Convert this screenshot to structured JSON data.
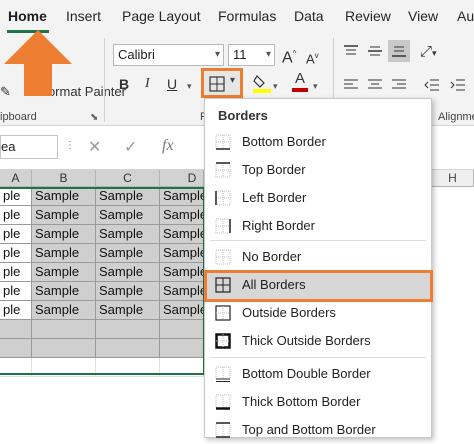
{
  "ribbon_tabs": {
    "home": "Home",
    "insert": "Insert",
    "page_layout": "Page Layout",
    "formulas": "Formulas",
    "data": "Data",
    "review": "Review",
    "view": "View",
    "au": "Au"
  },
  "clipboard": {
    "format_painter": "Format Painter",
    "group_label": "ipboard"
  },
  "font": {
    "name": "Calibri",
    "size": "11",
    "bold": "B",
    "italic": "I",
    "underline": "U",
    "grow_label": "A",
    "shrink_label": "A",
    "font_color_label": "A",
    "group_label": "F"
  },
  "alignment": {
    "group_label": "Alignme"
  },
  "formula_bar": {
    "name_box": "ea",
    "fx": "fx"
  },
  "columns": [
    "A",
    "B",
    "C",
    "D",
    "H"
  ],
  "rows": [
    [
      "ple",
      "Sample",
      "Sample",
      "Sample"
    ],
    [
      "ple",
      "Sample",
      "Sample",
      "Sample"
    ],
    [
      "ple",
      "Sample",
      "Sample",
      "Sample"
    ],
    [
      "ple",
      "Sample",
      "Sample",
      "Sample"
    ],
    [
      "ple",
      "Sample",
      "Sample",
      "Sample"
    ],
    [
      "ple",
      "Sample",
      "Sample",
      "Sample"
    ],
    [
      "ple",
      "Sample",
      "Sample",
      "Sample"
    ]
  ],
  "borders_menu": {
    "title": "Borders",
    "items": [
      {
        "label": "Bottom Border",
        "icon": "bottom-border-icon"
      },
      {
        "label": "Top Border",
        "icon": "top-border-icon"
      },
      {
        "label": "Left Border",
        "icon": "left-border-icon"
      },
      {
        "label": "Right Border",
        "icon": "right-border-icon"
      },
      {
        "label": "No Border",
        "icon": "no-border-icon"
      },
      {
        "label": "All Borders",
        "icon": "all-borders-icon",
        "highlighted": true
      },
      {
        "label": "Outside Borders",
        "icon": "outside-borders-icon"
      },
      {
        "label": "Thick Outside Borders",
        "icon": "thick-outside-borders-icon"
      },
      {
        "label": "Bottom Double Border",
        "icon": "bottom-double-border-icon"
      },
      {
        "label": "Thick Bottom Border",
        "icon": "thick-bottom-border-icon"
      },
      {
        "label": "Top and Bottom Border",
        "icon": "top-bottom-border-icon"
      }
    ]
  },
  "colors": {
    "accent_orange": "#ed7d31",
    "excel_green": "#217346",
    "selection_gray": "#cfcfcf"
  }
}
